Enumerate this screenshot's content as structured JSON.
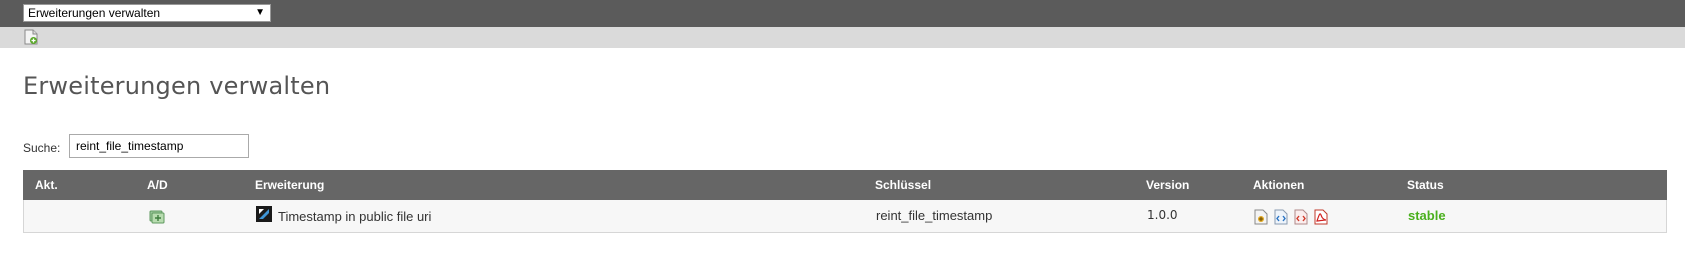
{
  "topbar": {
    "module_select": "Erweiterungen verwalten"
  },
  "toolbar": {
    "icons": [
      "add-extension-icon"
    ]
  },
  "page": {
    "title": "Erweiterungen verwalten"
  },
  "search": {
    "label": "Suche:",
    "value": "reint_file_timestamp"
  },
  "table": {
    "columns": [
      "Akt.",
      "A/D",
      "Erweiterung",
      "Schlüssel",
      "Version",
      "Aktionen",
      "Status"
    ],
    "rows": [
      {
        "akt": "",
        "extension": "Timestamp in public file uri",
        "key": "reint_file_timestamp",
        "version": "1.0.0",
        "actions": [
          "configure-icon",
          "code-icon",
          "remove-code-icon",
          "pdf-icon"
        ],
        "status": "stable"
      }
    ]
  },
  "colors": {
    "topbar": "#5b5b5b",
    "toolbar": "#dadada",
    "header": "#666666",
    "status_stable": "#4ab01d"
  }
}
